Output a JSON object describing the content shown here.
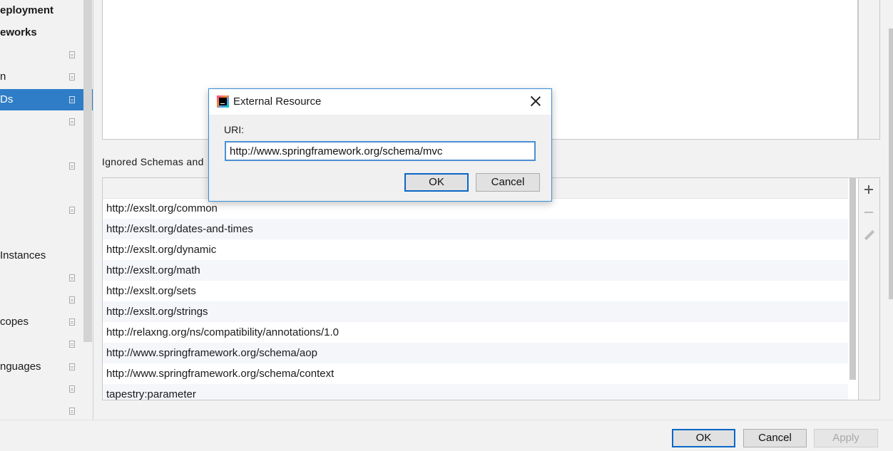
{
  "sidebar": {
    "items": [
      {
        "label": "eployment",
        "bold": true,
        "doc": false
      },
      {
        "label": "eworks",
        "bold": true,
        "doc": false
      },
      {
        "label": "",
        "bold": false,
        "doc": true
      },
      {
        "label": "n",
        "bold": false,
        "doc": true
      },
      {
        "label": "Ds",
        "bold": false,
        "doc": true,
        "selected": true
      },
      {
        "label": "",
        "bold": false,
        "doc": true
      },
      {
        "label": "",
        "bold": false,
        "doc": true
      },
      {
        "label": "",
        "bold": false,
        "doc": true
      },
      {
        "label": "Instances",
        "bold": false,
        "doc": false
      },
      {
        "label": "",
        "bold": false,
        "doc": true
      },
      {
        "label": "",
        "bold": false,
        "doc": true
      },
      {
        "label": "copes",
        "bold": false,
        "doc": true
      },
      {
        "label": "",
        "bold": false,
        "doc": true
      },
      {
        "label": "nguages",
        "bold": false,
        "doc": true
      },
      {
        "label": "",
        "bold": false,
        "doc": true
      },
      {
        "label": "",
        "bold": false,
        "doc": true
      }
    ]
  },
  "ignored_section": {
    "label": "Ignored Schemas and",
    "rows": [
      "http://exslt.org/common",
      "http://exslt.org/dates-and-times",
      "http://exslt.org/dynamic",
      "http://exslt.org/math",
      "http://exslt.org/sets",
      "http://exslt.org/strings",
      "http://relaxng.org/ns/compatibility/annotations/1.0",
      "http://www.springframework.org/schema/aop",
      "http://www.springframework.org/schema/context",
      "tapestry:parameter"
    ]
  },
  "dialog": {
    "title": "External Resource",
    "uri_label": "URI:",
    "uri_value": "http://www.springframework.org/schema/mvc",
    "ok_label": "OK",
    "cancel_label": "Cancel"
  },
  "footer": {
    "ok_label": "OK",
    "cancel_label": "Cancel",
    "apply_label": "Apply"
  },
  "colors": {
    "selection": "#2f7dc6",
    "dialog_border": "#3a8ed8",
    "default_button_border": "#0a67c6"
  }
}
